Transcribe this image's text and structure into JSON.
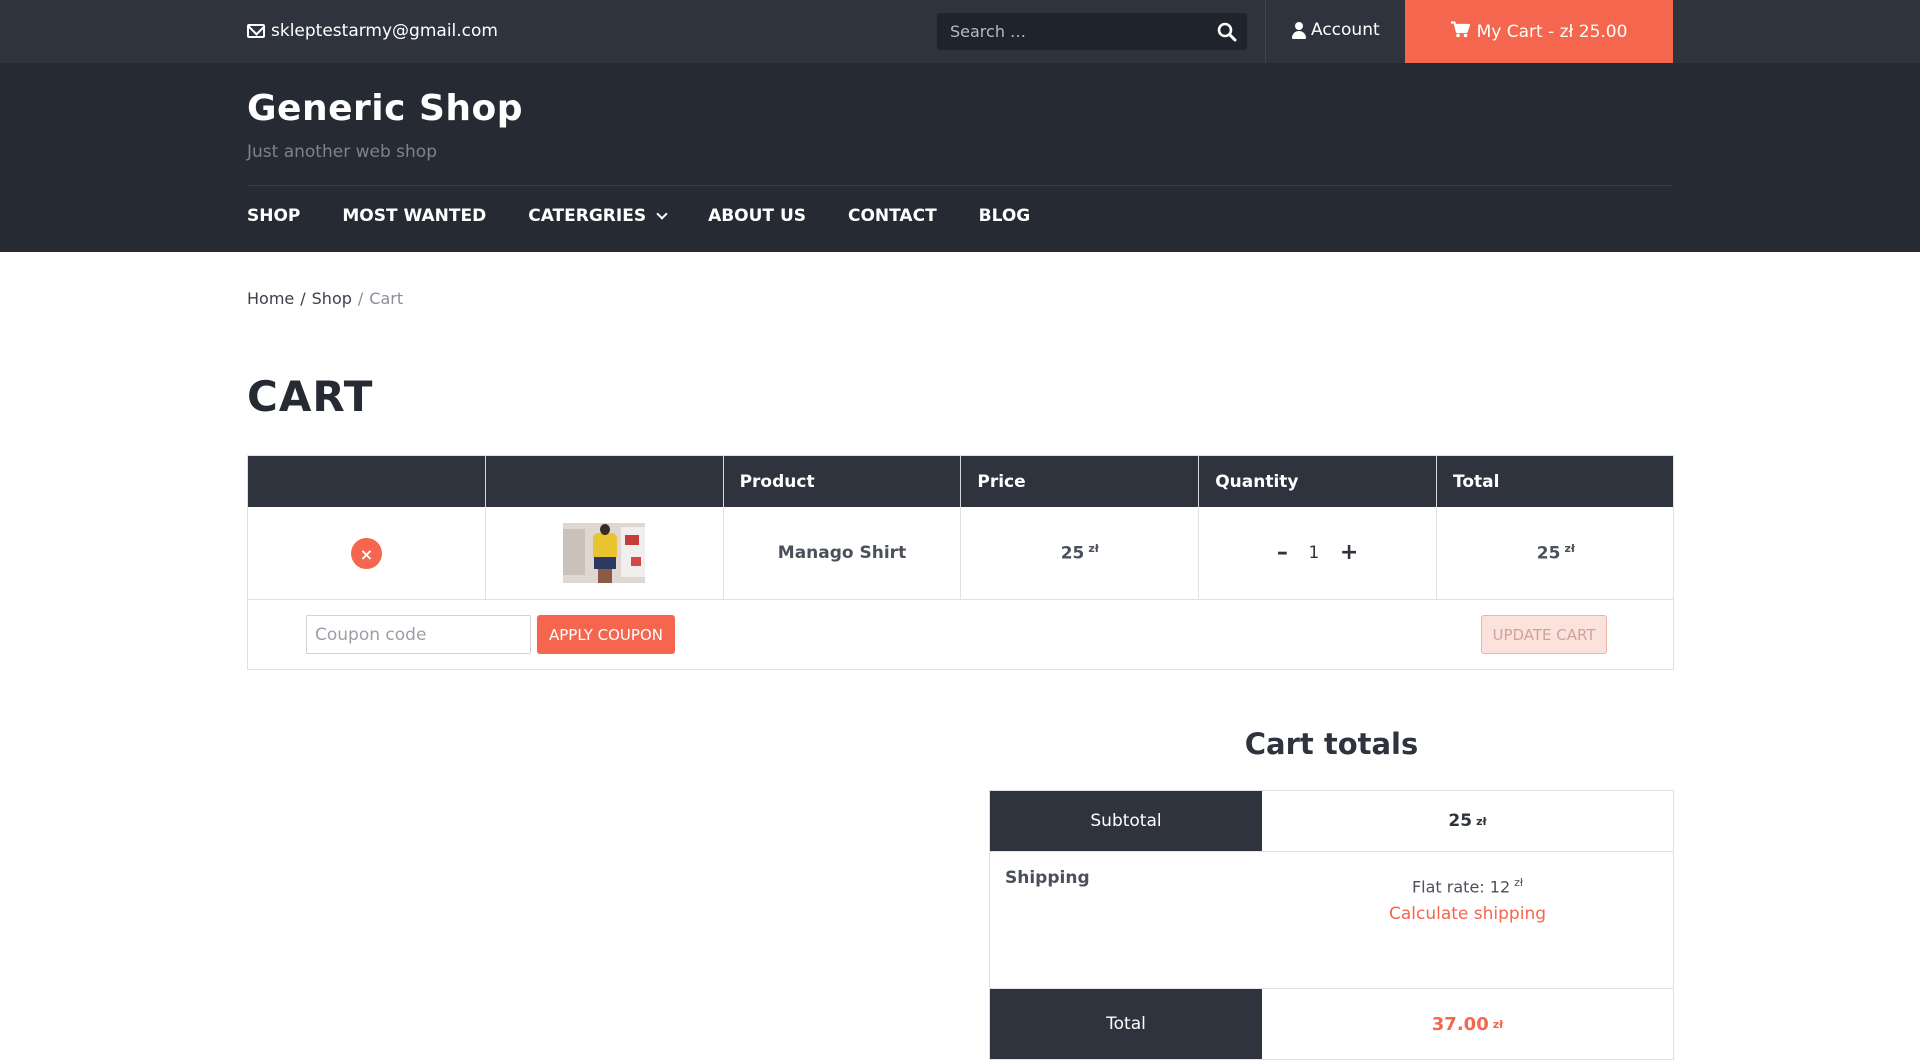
{
  "topbar": {
    "email": "skleptestarmy@gmail.com",
    "search_placeholder": "Search …",
    "account_label": "Account",
    "cart_label": "My Cart - zł 25.00"
  },
  "header": {
    "title": "Generic Shop",
    "tagline": "Just another web shop"
  },
  "nav": {
    "items": [
      "SHOP",
      "MOST WANTED",
      "CATERGRIES",
      "ABOUT US",
      "CONTACT",
      "BLOG"
    ]
  },
  "breadcrumb": {
    "home": "Home",
    "sep1": "/",
    "shop": "Shop",
    "sep2": "/",
    "current": "Cart"
  },
  "page": {
    "title": "CART"
  },
  "cart": {
    "headers": [
      "",
      "",
      "Product",
      "Price",
      "Quantity",
      "Total"
    ],
    "remove_glyph": "×",
    "items": [
      {
        "product": "Manago Shirt",
        "price": "25",
        "currency": "zł",
        "quantity": "1",
        "total": "25"
      }
    ],
    "qty_minus": "–",
    "qty_plus": "+",
    "coupon_placeholder": "Coupon code",
    "apply_coupon": "APPLY COUPON",
    "update_cart": "UPDATE CART"
  },
  "totals": {
    "title": "Cart totals",
    "subtotal_label": "Subtotal",
    "subtotal_value": "25",
    "shipping_label": "Shipping",
    "shipping_value": "Flat rate: 12",
    "calculate_shipping": "Calculate shipping",
    "total_label": "Total",
    "total_value": "37.00",
    "currency": "zł"
  },
  "colors": {
    "accent": "#f4664d",
    "dark": "#2e333d",
    "header_bg": "#262a32"
  },
  "icons": [
    "envelope-icon",
    "search-icon",
    "user-icon",
    "cart-icon",
    "chevron-down-icon",
    "remove-icon"
  ]
}
